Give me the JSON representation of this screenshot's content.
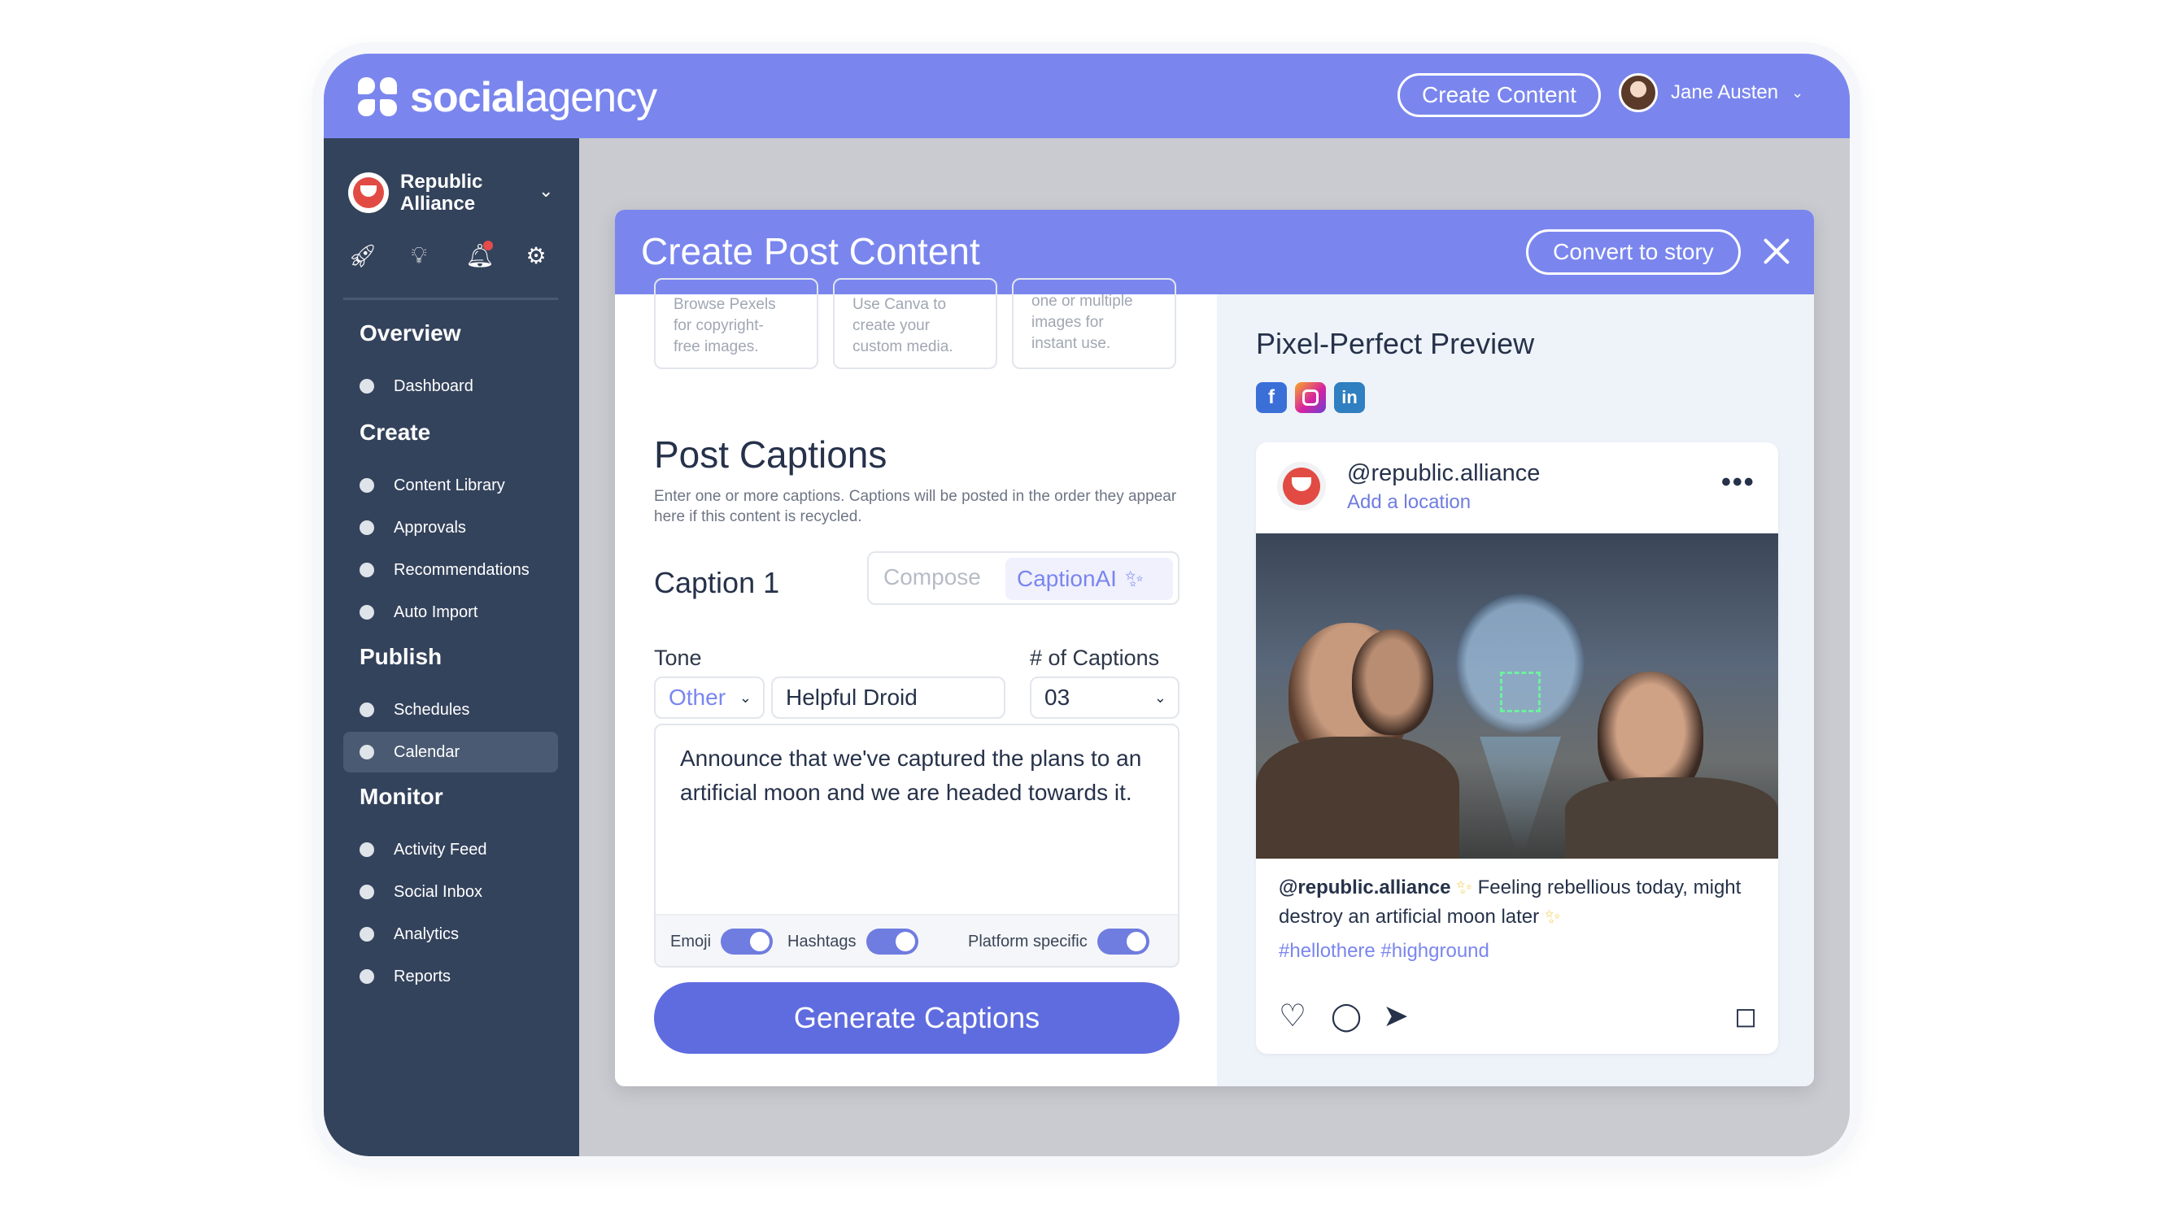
{
  "app": {
    "logo_bold": "social",
    "logo_thin": "agency",
    "create_content_label": "Create Content",
    "user_name": "Jane Austen"
  },
  "sidebar": {
    "brand_line1": "Republic",
    "brand_line2": "Alliance",
    "sections": {
      "overview": "Overview",
      "create": "Create",
      "publish": "Publish",
      "monitor": "Monitor"
    },
    "items": {
      "dashboard": "Dashboard",
      "content_library": "Content Library",
      "approvals": "Approvals",
      "recommendations": "Recommendations",
      "auto_import": "Auto Import",
      "schedules": "Schedules",
      "calendar": "Calendar",
      "activity_feed": "Activity Feed",
      "social_inbox": "Social Inbox",
      "analytics": "Analytics",
      "reports": "Reports"
    },
    "active_item": "Calendar"
  },
  "modal": {
    "title": "Create Post Content",
    "convert_label": "Convert to story",
    "source_cards": [
      {
        "line1": "Browse Pexels",
        "line2": "for copyright-",
        "line3": "free images."
      },
      {
        "line1": "Use Canva to",
        "line2": "create your",
        "line3": "custom media."
      },
      {
        "line1": "one or multiple",
        "line2": "images for",
        "line3": "instant use."
      }
    ],
    "captions": {
      "heading": "Post Captions",
      "description": "Enter one or more captions. Captions will be posted in the order they appear here if this content is recycled.",
      "caption_label": "Caption 1",
      "tab_compose": "Compose",
      "tab_ai": "CaptionAI",
      "tone_label": "Tone",
      "tone_value": "Other",
      "tone_custom": "Helpful Droid",
      "count_label": "# of Captions",
      "count_value": "03",
      "prompt": "Announce that we've captured the plans to an artificial moon and we are headed towards it.",
      "toggle_emoji": "Emoji",
      "toggle_hashtags": "Hashtags",
      "toggle_platform": "Platform specific",
      "generate_label": "Generate Captions"
    },
    "preview": {
      "heading": "Pixel-Perfect Preview",
      "handle": "@republic.alliance",
      "location": "Add a location",
      "caption_handle": "@republic.alliance",
      "caption_text_1": "Feeling rebellious today, might destroy an artificial moon later",
      "hashtags": "#hellothere #highground"
    }
  },
  "colors": {
    "brand": "#7a86ee",
    "sidebar": "#34435c",
    "primary_button": "#5f6ce0",
    "facebook": "#3b6fd8",
    "instagram": "#d6249f",
    "linkedin": "#2f7fc1"
  },
  "icons": [
    "rocket-icon",
    "lightbulb-icon",
    "bell-icon",
    "gear-icon",
    "close-icon",
    "magic-wand-icon",
    "heart-icon",
    "comment-icon",
    "send-icon",
    "bookmark-icon",
    "more-icon"
  ]
}
